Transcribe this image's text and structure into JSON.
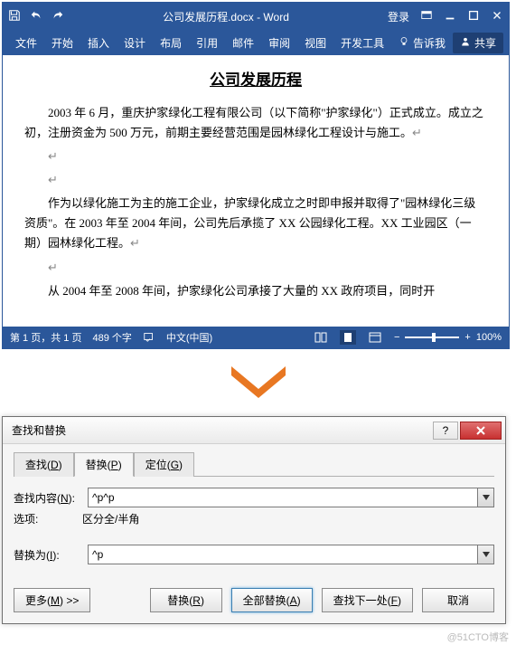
{
  "titlebar": {
    "title": "公司发展历程.docx - Word",
    "login": "登录"
  },
  "ribbon": {
    "tabs": [
      "文件",
      "开始",
      "插入",
      "设计",
      "布局",
      "引用",
      "邮件",
      "审阅",
      "视图",
      "开发工具"
    ],
    "tell_me": "告诉我",
    "share": "共享"
  },
  "doc": {
    "title": "公司发展历程",
    "p1": "2003 年 6 月，重庆护家绿化工程有限公司（以下简称\"护家绿化\"）正式成立。成立之初，注册资金为 500 万元，前期主要经营范围是园林绿化工程设计与施工。",
    "p2": "作为以绿化施工为主的施工企业，护家绿化成立之时即申报并取得了\"园林绿化三级资质\"。在 2003 年至 2004 年间，公司先后承揽了 XX 公园绿化工程。XX 工业园区（一期）园林绿化工程。",
    "p3": "从 2004 年至 2008 年间，护家绿化公司承接了大量的 XX 政府项目，同时开"
  },
  "statusbar": {
    "page": "第 1 页，共 1 页",
    "words": "489 个字",
    "lang": "中文(中国)",
    "zoom": "100%"
  },
  "dialog": {
    "title": "查找和替换",
    "tabs": {
      "find": "查找(D)",
      "replace": "替换(P)",
      "goto": "定位(G)"
    },
    "find_label": "查找内容(N):",
    "find_value": "^p^p",
    "options_label": "选项:",
    "options_value": "区分全/半角",
    "replace_label": "替换为(I):",
    "replace_value": "^p",
    "buttons": {
      "more": "更多(M) >>",
      "replace": "替换(R)",
      "replace_all": "全部替换(A)",
      "find_next": "查找下一处(F)",
      "cancel": "取消"
    }
  },
  "watermark": "@51CTO博客"
}
